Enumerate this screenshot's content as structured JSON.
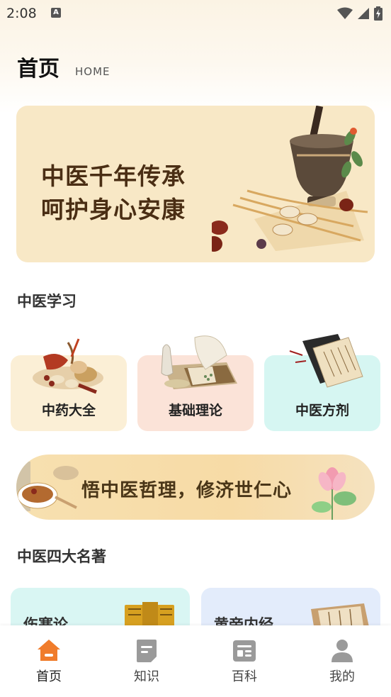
{
  "status_bar": {
    "time": "2:08"
  },
  "header": {
    "title": "首页",
    "subtitle": "HOME"
  },
  "hero": {
    "line1": "中医千年传承",
    "line2": "呵护身心安康"
  },
  "study_section": {
    "title": "中医学习",
    "cards": [
      {
        "label": "中药大全",
        "bg": "#fbefd6"
      },
      {
        "label": "基础理论",
        "bg": "#fbe3d8"
      },
      {
        "label": "中医方剂",
        "bg": "#d6f6f2"
      }
    ]
  },
  "slogan": {
    "text": "悟中医哲理，修济世仁心"
  },
  "classics_section": {
    "title": "中医四大名著",
    "books": [
      {
        "label": "伤寒论",
        "bg": "#d9f6f3"
      },
      {
        "label": "黄帝内经",
        "bg": "#e3ecfb"
      }
    ]
  },
  "nav": {
    "items": [
      {
        "label": "首页",
        "active": true
      },
      {
        "label": "知识",
        "active": false
      },
      {
        "label": "百科",
        "active": false
      },
      {
        "label": "我的",
        "active": false
      }
    ],
    "active_color": "#f07c2b",
    "inactive_color": "#9a9a9a"
  }
}
